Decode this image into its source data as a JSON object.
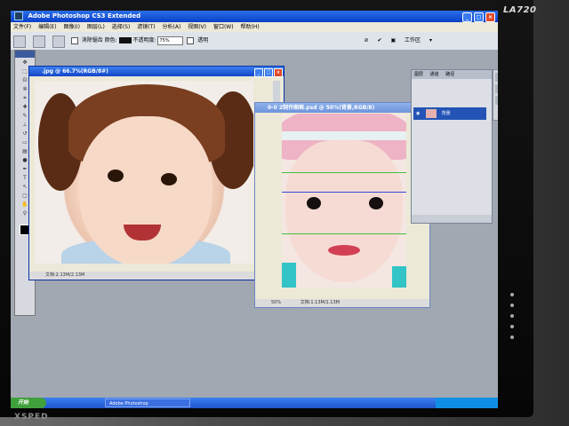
{
  "monitor": {
    "brand": "LA720",
    "logo": "XSPED"
  },
  "window": {
    "title": "Adobe Photoshop CS3 Extended"
  },
  "menu": [
    "文件(F)",
    "编辑(E)",
    "图像(I)",
    "图层(L)",
    "选择(S)",
    "滤镜(T)",
    "分析(A)",
    "视图(V)",
    "窗口(W)",
    "帮助(H)"
  ],
  "options": {
    "antialias": "消除锯齿",
    "color_label": "颜色:",
    "opacity_label": "不透明度:",
    "opacity_value": "75%",
    "transparency": "透明",
    "workspace": "工作区"
  },
  "doc1": {
    "title": ".jpg @ 66.7%(RGB/8#)",
    "status": "文档:2.13M/2.13M"
  },
  "doc2": {
    "title": "0-0 2制作图框.psd @ 50%(背景,RGB/8)",
    "zoom": "50%",
    "status": "文档:1.13M/1.13M"
  },
  "panel": {
    "tabs": [
      "图层",
      "通道",
      "路径"
    ],
    "layer_name": "背景"
  },
  "taskbar": {
    "start": "开始",
    "task": "Adobe Photoshop"
  },
  "icons": [
    "ps-icon",
    "close-icon",
    "minimize-icon",
    "maximize-icon",
    "eye-icon",
    "workspace-icon"
  ]
}
